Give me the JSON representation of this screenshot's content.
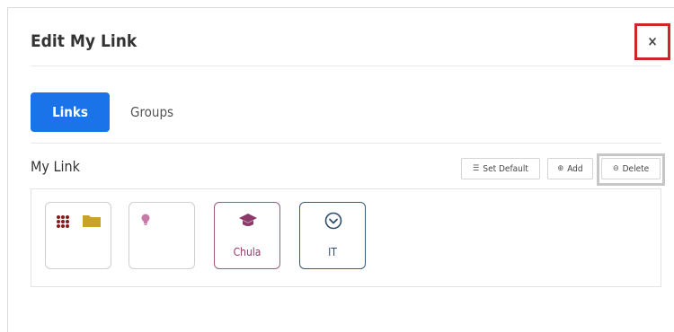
{
  "dialog": {
    "title": "Edit My Link",
    "close_label": "×"
  },
  "tabs": [
    {
      "label": "Links",
      "active": true
    },
    {
      "label": "Groups",
      "active": false
    }
  ],
  "section": {
    "title": "My Link"
  },
  "toolbar": {
    "set_default_label": "Set Default",
    "add_label": "Add",
    "delete_label": "Delete"
  },
  "tiles": [
    {
      "label": "",
      "icons": [
        "apps-grid-icon",
        "folder-icon"
      ]
    },
    {
      "label": "",
      "icons": [
        "lightbulb-icon"
      ]
    },
    {
      "label": "Chula",
      "icons": [
        "graduation-cap-icon"
      ]
    },
    {
      "label": "IT",
      "icons": [
        "chevron-circle-icon"
      ]
    }
  ],
  "colors": {
    "accent": "#1a73e8",
    "close_highlight": "#d2232a",
    "delete_highlight": "#c6c6c6",
    "chula": "#9c5a7e",
    "it": "#3b5a78",
    "folder": "#c9a227",
    "grid_dots": "#8a1a1a",
    "bulb": "#c77aa8"
  }
}
